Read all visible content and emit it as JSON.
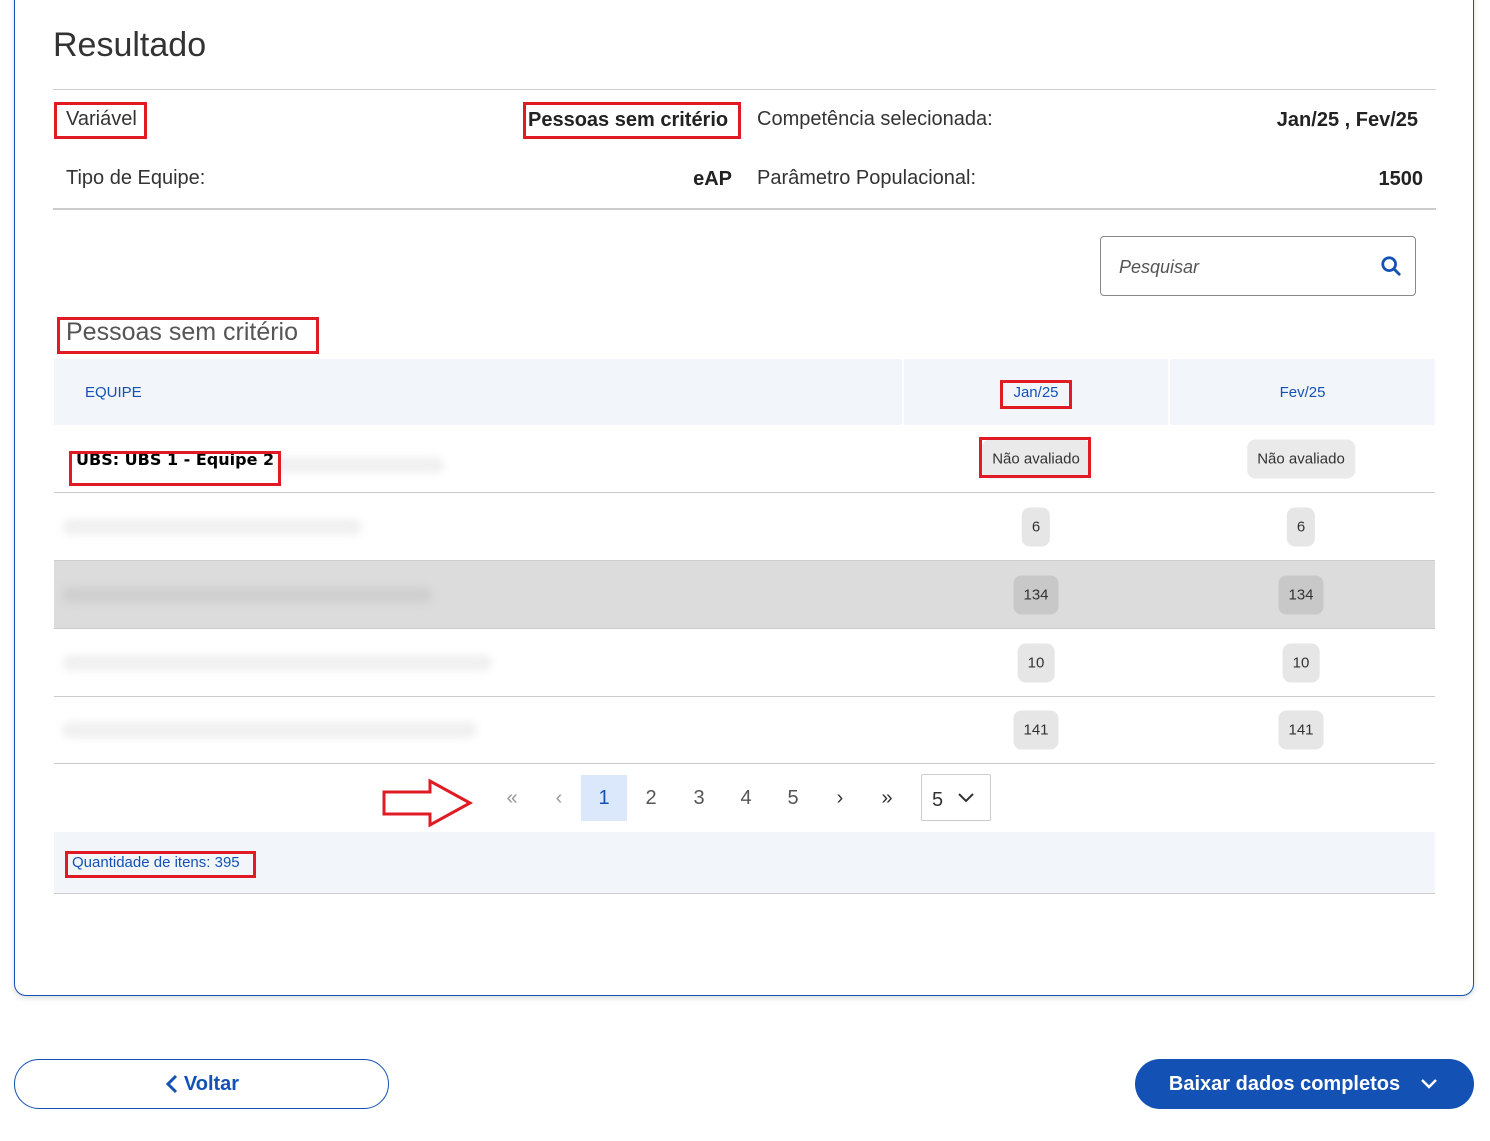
{
  "page": {
    "title": "Resultado"
  },
  "info": {
    "variavel_label": "Variável",
    "variavel_value": "Pessoas sem critério",
    "competencia_label": "Competência selecionada:",
    "competencia_value": "Jan/25 , Fev/25",
    "tipo_equipe_label": "Tipo de Equipe:",
    "tipo_equipe_value": "eAP",
    "parametro_label": "Parâmetro Populacional:",
    "parametro_value": "1500"
  },
  "search": {
    "placeholder": "Pesquisar",
    "icon": "search-icon"
  },
  "table": {
    "title": "Pessoas sem critério",
    "columns": [
      "EQUIPE",
      "Jan/25",
      "Fev/25"
    ],
    "rows": [
      {
        "equipe": "UBS: UBS 1 - Equipe 2",
        "jan": "Não avaliado",
        "fev": "Não avaliado"
      },
      {
        "equipe": "",
        "jan": "6",
        "fev": "6"
      },
      {
        "equipe": "",
        "jan": "134",
        "fev": "134"
      },
      {
        "equipe": "",
        "jan": "10",
        "fev": "10"
      },
      {
        "equipe": "",
        "jan": "141",
        "fev": "141"
      }
    ]
  },
  "pagination": {
    "first": "«",
    "prev": "‹",
    "pages": [
      "1",
      "2",
      "3",
      "4",
      "5"
    ],
    "current": "1",
    "next": "›",
    "last": "»",
    "page_size": "5"
  },
  "footer": {
    "quantidade": "Quantidade de itens: 395"
  },
  "buttons": {
    "back": "Voltar",
    "download": "Baixar dados completos"
  },
  "colors": {
    "primary": "#1351b4",
    "highlight": "#e01b24"
  }
}
